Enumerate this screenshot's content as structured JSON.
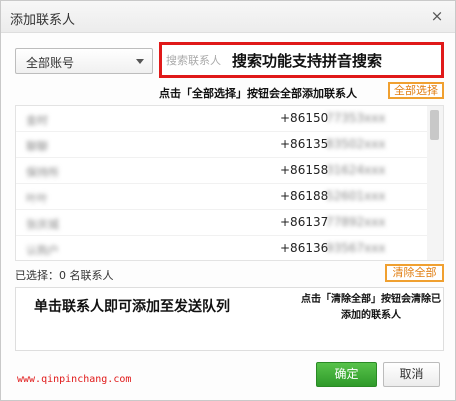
{
  "dialog": {
    "title": "添加联系人",
    "close_icon": "×"
  },
  "account_select": {
    "value": "全部账号",
    "icon": "chevron-down-icon"
  },
  "search": {
    "placeholder": "搜索联系人",
    "annotation": "搜索功能支持拼音搜索",
    "border_color": "#e01919"
  },
  "select_all": {
    "annotation": "点击「全部选择」按钮会全部添加联系人",
    "button_label": "全部选择",
    "highlight_color": "#f0a030"
  },
  "contacts": [
    {
      "name": "金时",
      "phone": "+86150",
      "phone_rest": "77353xxx"
    },
    {
      "name": "聊聊",
      "phone": "+86135",
      "phone_rest": "83502xxx"
    },
    {
      "name": "保持所",
      "phone": "+86158",
      "phone_rest": "31624xxx"
    },
    {
      "name": "叶叶",
      "phone": "+86188",
      "phone_rest": "52601xxx"
    },
    {
      "name": "张庆城",
      "phone": "+86137",
      "phone_rest": "77892xxx"
    },
    {
      "name": "认购户",
      "phone": "+86136",
      "phone_rest": "93567xxx"
    }
  ],
  "selection": {
    "count_text": "已选择：0 名联系人",
    "clear_button_label": "清除全部"
  },
  "queue": {
    "annotation": "单击联系人即可添加至发送队列",
    "clear_annotation": "点击「清除全部」按钮会清除已添加的联系人"
  },
  "footer": {
    "website": "www.qinpinchang.com",
    "ok_label": "确定",
    "cancel_label": "取消",
    "ok_color": "#3aa833"
  }
}
